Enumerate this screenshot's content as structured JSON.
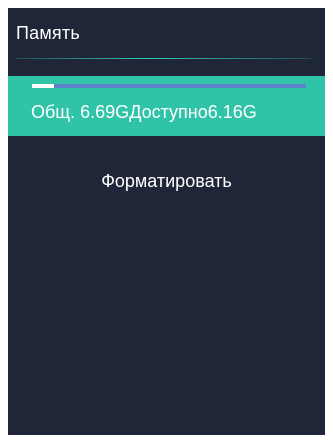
{
  "header": {
    "title": "Память"
  },
  "storage": {
    "total_label": "Общ.",
    "total_value": "6.69G",
    "available_label": "Доступно",
    "available_value": "6.16G",
    "used_fraction": 0.08
  },
  "actions": {
    "format_label": "Форматировать"
  },
  "colors": {
    "panel_background": "#1f2637",
    "selected_row": "#2fc4a8",
    "progress_track": "#5f82c9",
    "progress_fill": "#ffffff",
    "divider_accent": "#37c9b0"
  }
}
